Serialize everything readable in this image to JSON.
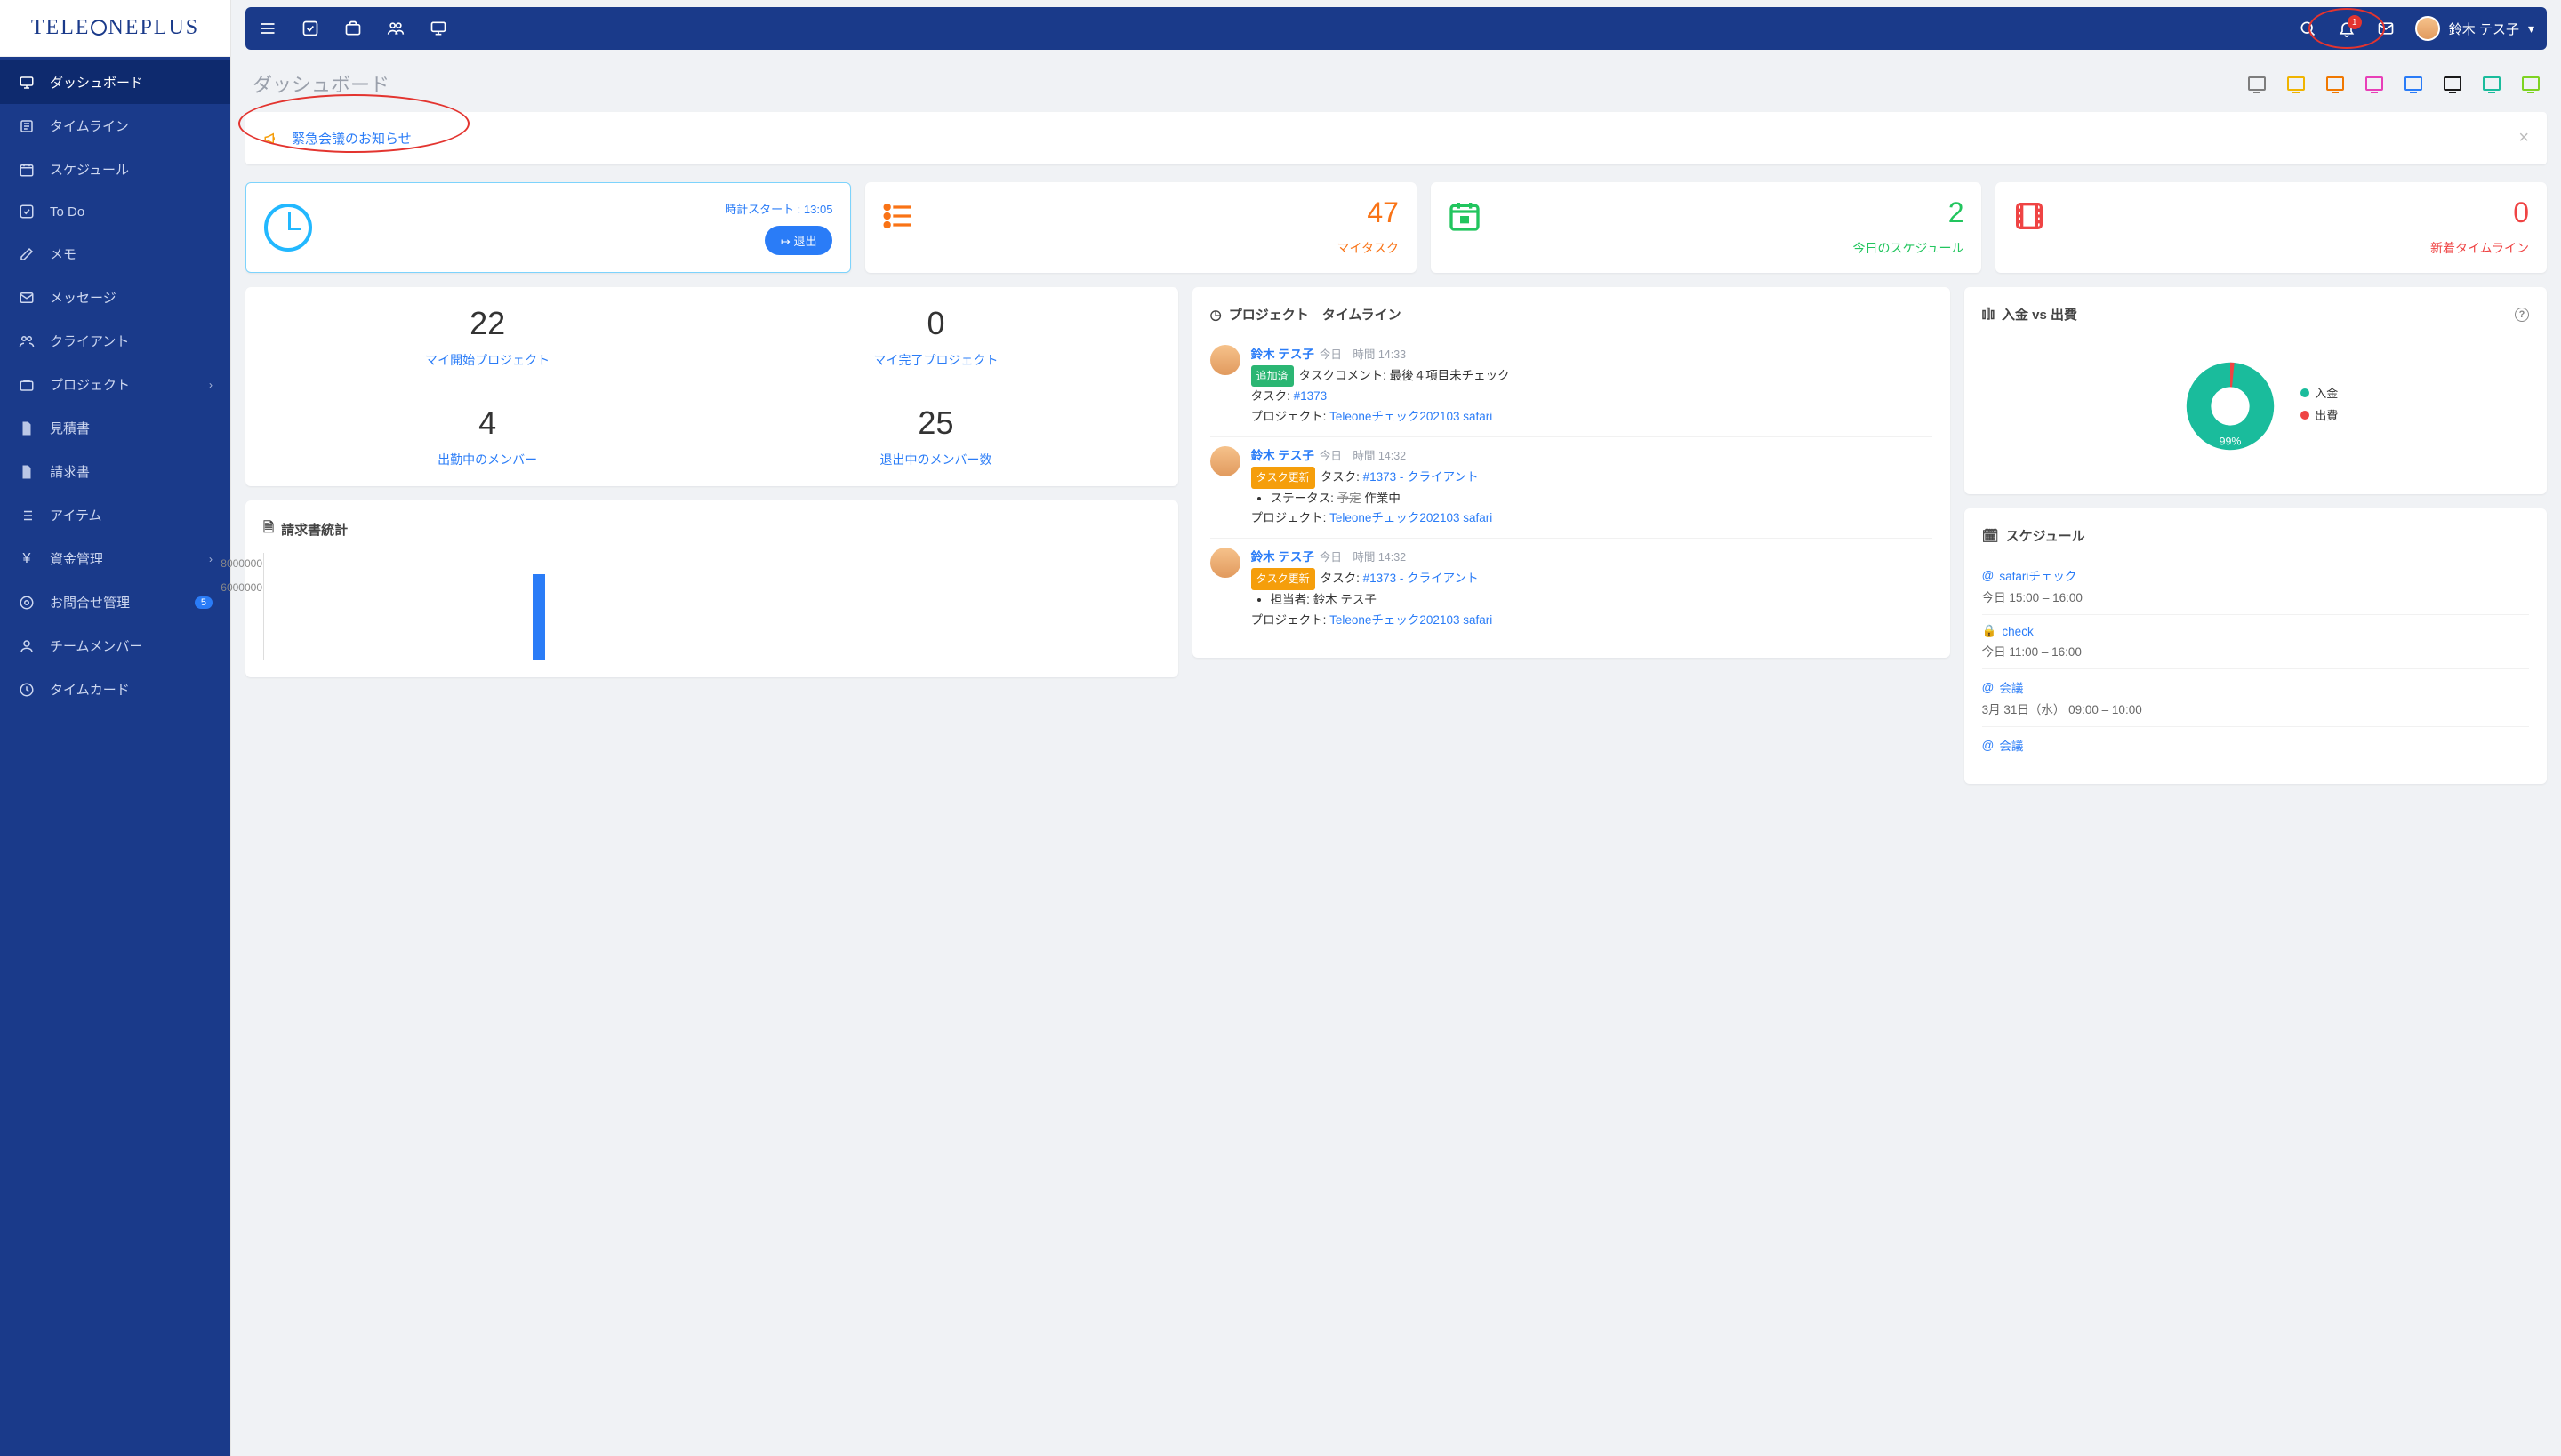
{
  "app_name": "TELEONEPLUS",
  "user": {
    "name": "鈴木 テス子"
  },
  "notifications_count": "1",
  "sidebar": {
    "items": [
      {
        "label": "ダッシュボード",
        "icon": "dashboard",
        "active": true
      },
      {
        "label": "タイムライン",
        "icon": "timeline"
      },
      {
        "label": "スケジュール",
        "icon": "calendar"
      },
      {
        "label": "To Do",
        "icon": "check"
      },
      {
        "label": "メモ",
        "icon": "edit"
      },
      {
        "label": "メッセージ",
        "icon": "mail"
      },
      {
        "label": "クライアント",
        "icon": "users"
      },
      {
        "label": "プロジェクト",
        "icon": "briefcase",
        "expandable": true
      },
      {
        "label": "見積書",
        "icon": "file"
      },
      {
        "label": "請求書",
        "icon": "file"
      },
      {
        "label": "アイテム",
        "icon": "list"
      },
      {
        "label": "資金管理",
        "icon": "yen",
        "expandable": true
      },
      {
        "label": "お問合せ管理",
        "icon": "support",
        "badge": "5"
      },
      {
        "label": "チームメンバー",
        "icon": "user"
      },
      {
        "label": "タイムカード",
        "icon": "clock"
      }
    ]
  },
  "page_title": "ダッシュボード",
  "filter_colors": [
    "#7d7d7d",
    "#f0b400",
    "#f07800",
    "#e83fb8",
    "#2a7cf7",
    "#1a1a1a",
    "#1abc9c",
    "#7ed321"
  ],
  "notice": {
    "text": "緊急会議のお知らせ"
  },
  "clock": {
    "label_prefix": "時計スタート : ",
    "time": "13:05",
    "exit_label": "退出"
  },
  "top_stats": [
    {
      "value": "47",
      "label": "マイタスク",
      "color": "#f97316",
      "icon": "list"
    },
    {
      "value": "2",
      "label": "今日のスケジュール",
      "color": "#22c55e",
      "icon": "calendar"
    },
    {
      "value": "0",
      "label": "新着タイムライン",
      "color": "#ef4444",
      "icon": "film"
    }
  ],
  "dual_stats": [
    {
      "value": "22",
      "label": "マイ開始プロジェクト"
    },
    {
      "value": "0",
      "label": "マイ完了プロジェクト"
    },
    {
      "value": "4",
      "label": "出勤中のメンバー"
    },
    {
      "value": "25",
      "label": "退出中のメンバー数"
    }
  ],
  "timeline_panel_title": "プロジェクト　タイムライン",
  "timeline": [
    {
      "name": "鈴木 テス子",
      "day": "今日",
      "time": "時間 14:33",
      "tag": {
        "kind": "g",
        "text": "追加済"
      },
      "line1_a": "タスクコメント: 最後４項目未チェック",
      "task_label": "タスク: ",
      "task_link": "#1373",
      "proj_label": "プロジェクト: ",
      "proj_link": "Teleoneチェック202103 safari"
    },
    {
      "name": "鈴木 テス子",
      "day": "今日",
      "time": "時間 14:32",
      "tag": {
        "kind": "o",
        "text": "タスク更新"
      },
      "line1_a": "タスク: ",
      "line1_link": "#1373 - クライアント",
      "bullet_label": "ステータス: ",
      "bullet_strike": "予定",
      "bullet_after": " 作業中",
      "proj_label": "プロジェクト: ",
      "proj_link": "Teleoneチェック202103 safari"
    },
    {
      "name": "鈴木 テス子",
      "day": "今日",
      "time": "時間 14:32",
      "tag": {
        "kind": "o",
        "text": "タスク更新"
      },
      "line1_a": "タスク: ",
      "line1_link": "#1373 - クライアント",
      "bullet_label": "担当者: ",
      "bullet_after": "鈴木 テス子",
      "proj_label": "プロジェクト: ",
      "proj_link": "Teleoneチェック202103 safari"
    }
  ],
  "donut_title": "入金 vs 出費",
  "donut_percent": "99%",
  "donut_legend": [
    {
      "label": "入金",
      "color": "#1abc9c"
    },
    {
      "label": "出費",
      "color": "#ef4444"
    }
  ],
  "schedule_title": "スケジュール",
  "schedule": [
    {
      "icon": "@",
      "title": "safariチェック",
      "time": "今日 15:00 – 16:00"
    },
    {
      "icon": "lock",
      "title": "check",
      "time": "今日 11:00 – 16:00"
    },
    {
      "icon": "@",
      "title": "会議",
      "time": "3月 31日（水） 09:00 – 10:00"
    },
    {
      "icon": "@",
      "title": "会議",
      "time": ""
    }
  ],
  "invoice_chart_title": "請求書統計",
  "chart_data": {
    "type": "bar",
    "ylim": [
      0,
      9000000
    ],
    "yticks": [
      6000000,
      8000000
    ],
    "values": [
      7200000
    ],
    "bar_positions_pct": [
      30
    ]
  }
}
